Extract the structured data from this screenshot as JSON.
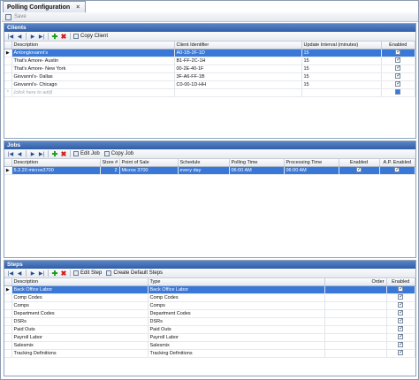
{
  "window": {
    "tab_title": "Polling Configuration",
    "close_glyph": "×"
  },
  "toolbar": {
    "save_label": "Save"
  },
  "clients": {
    "title": "Clients",
    "copy_label": "Copy Client",
    "columns": [
      "Description",
      "Client Identifier",
      "Update Interval (minutes)",
      "Enabled"
    ],
    "rows": [
      {
        "description": "Antongiovanni's",
        "id": "A0-1B-2F-1D",
        "interval": "15",
        "enabled": true,
        "selected": true
      },
      {
        "description": "That's Amore- Austin",
        "id": "B1-FF-2C-1H",
        "interval": "15",
        "enabled": true
      },
      {
        "description": "That's Amore- New York",
        "id": "00-2E-40-1F",
        "interval": "15",
        "enabled": true
      },
      {
        "description": "Giovanni's- Dallas",
        "id": "3F-A6-FF-1B",
        "interval": "15",
        "enabled": true
      },
      {
        "description": "Giovanni's- Chicago",
        "id": "C0-00-1D-HH",
        "interval": "15",
        "enabled": true
      }
    ],
    "add_placeholder": "(click here to add)"
  },
  "jobs": {
    "title": "Jobs",
    "edit_label": "Edit Job",
    "copy_label": "Copy Job",
    "columns": [
      "Description",
      "Store #",
      "Point of Sale",
      "Schedule",
      "Polling Time",
      "Processing Time",
      "Enabled",
      "A.P. Enabled"
    ],
    "rows": [
      {
        "description": "5.2.20 micros3700",
        "store": "2",
        "pos": "Micros 3700",
        "schedule": "every day",
        "polling": "06:00 AM",
        "processing": "06:00 AM",
        "enabled": true,
        "ap_enabled": true,
        "selected": true
      }
    ]
  },
  "steps": {
    "title": "Steps",
    "edit_label": "Edit Step",
    "create_default_label": "Create Default Steps",
    "columns": [
      "Description",
      "Type",
      "Order",
      "Enabled"
    ],
    "rows": [
      {
        "description": "Back Office Labor",
        "type": "Back Office Labor",
        "enabled": true,
        "selected": true
      },
      {
        "description": "Comp Codes",
        "type": "Comp Codes",
        "enabled": true
      },
      {
        "description": "Comps",
        "type": "Comps",
        "enabled": true
      },
      {
        "description": "Department Codes",
        "type": "Department Codes",
        "enabled": true
      },
      {
        "description": "DSRs",
        "type": "DSRs",
        "enabled": true
      },
      {
        "description": "Paid Outs",
        "type": "Paid Outs",
        "enabled": true
      },
      {
        "description": "Payroll Labor",
        "type": "Payroll Labor",
        "enabled": true
      },
      {
        "description": "Salesmix",
        "type": "Salesmix",
        "enabled": true
      },
      {
        "description": "Tracking Definitions",
        "type": "Tracking Definitions",
        "enabled": true
      }
    ]
  },
  "nav_glyphs": {
    "first": "|◀",
    "prev": "◀",
    "next": "▶",
    "last": "▶|",
    "add": "✚",
    "delete": "✖"
  }
}
